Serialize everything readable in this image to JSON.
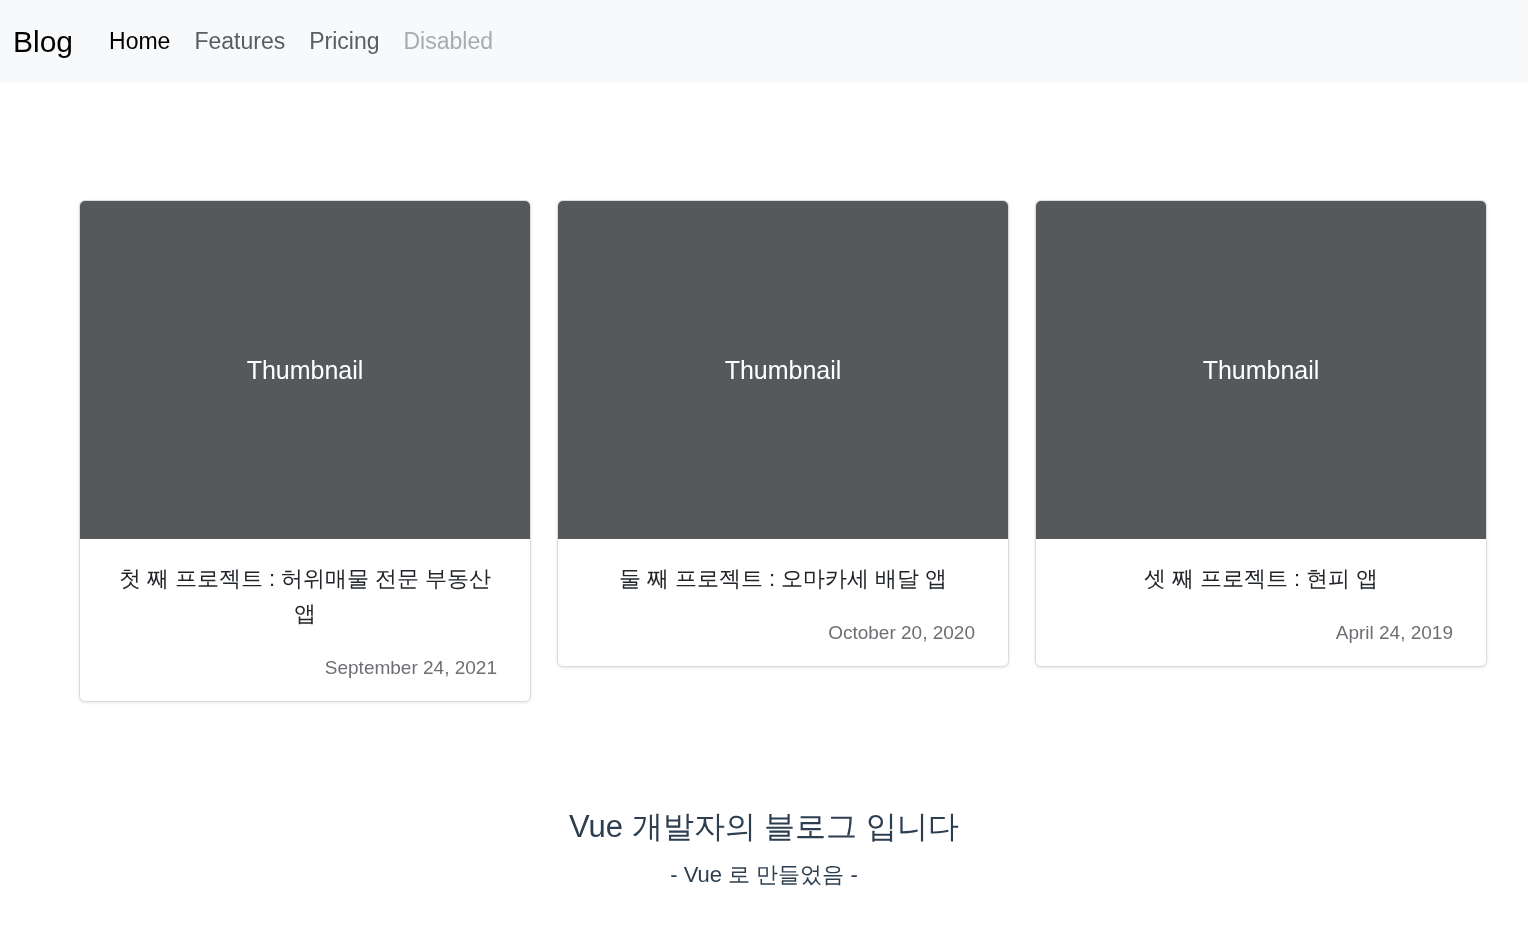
{
  "navbar": {
    "brand": "Blog",
    "links": [
      {
        "label": "Home",
        "selected": true,
        "disabled": false
      },
      {
        "label": "Features",
        "selected": false,
        "disabled": false
      },
      {
        "label": "Pricing",
        "selected": false,
        "disabled": false
      },
      {
        "label": "Disabled",
        "selected": false,
        "disabled": true
      }
    ]
  },
  "cards": [
    {
      "thumbnail": "Thumbnail",
      "title": "첫 째 프로젝트 : 허위매물 전문 부동산 앱",
      "date": "September 24, 2021"
    },
    {
      "thumbnail": "Thumbnail",
      "title": "둘 째 프로젝트 : 오마카세 배달 앱",
      "date": "October 20, 2020"
    },
    {
      "thumbnail": "Thumbnail",
      "title": "셋 째 프로젝트 : 현피 앱",
      "date": "April 24, 2019"
    }
  ],
  "footer": {
    "title": "Vue 개발자의 블로그 입니다",
    "subtitle": "- Vue 로 만들었음 -"
  }
}
